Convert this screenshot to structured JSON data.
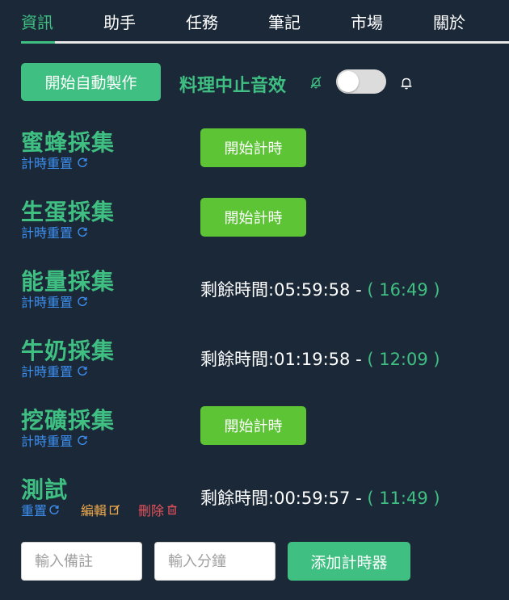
{
  "tabs": [
    {
      "label": "資訊",
      "active": true
    },
    {
      "label": "助手"
    },
    {
      "label": "任務"
    },
    {
      "label": "筆記"
    },
    {
      "label": "市場"
    },
    {
      "label": "關於"
    }
  ],
  "toolbar": {
    "auto_craft_label": "開始自動製作",
    "sound_label": "料理中止音效",
    "toggle_on": false
  },
  "timers": [
    {
      "name": "蜜蜂採集",
      "reset_label": "計時重置",
      "state": "idle",
      "start_label": "開始計時"
    },
    {
      "name": "生蛋採集",
      "reset_label": "計時重置",
      "state": "idle",
      "start_label": "開始計時"
    },
    {
      "name": "能量採集",
      "reset_label": "計時重置",
      "state": "running",
      "remaining_label": "剩餘時間:",
      "remaining": "05:59:58",
      "separator": " - ",
      "end_time": "( 16:49 )"
    },
    {
      "name": "牛奶採集",
      "reset_label": "計時重置",
      "state": "running",
      "remaining_label": "剩餘時間:",
      "remaining": "01:19:58",
      "separator": " - ",
      "end_time": "( 12:09 )"
    },
    {
      "name": "挖礦採集",
      "reset_label": "計時重置",
      "state": "idle",
      "start_label": "開始計時"
    },
    {
      "name": "測試",
      "reset_label": "重置",
      "edit_label": "編輯",
      "delete_label": "刪除",
      "state": "running",
      "remaining_label": "剩餘時間:",
      "remaining": "00:59:57",
      "separator": " - ",
      "end_time": "( 11:49 )"
    }
  ],
  "footer": {
    "note_placeholder": "輸入備註",
    "minutes_placeholder": "輸入分鐘",
    "add_label": "添加計時器"
  },
  "colors": {
    "background": "#1b2838",
    "accent": "#3fbf82",
    "start_button": "#5cc435",
    "link_blue": "#3d8ff0",
    "edit_orange": "#f0a94a",
    "delete_red": "#e8525a"
  }
}
